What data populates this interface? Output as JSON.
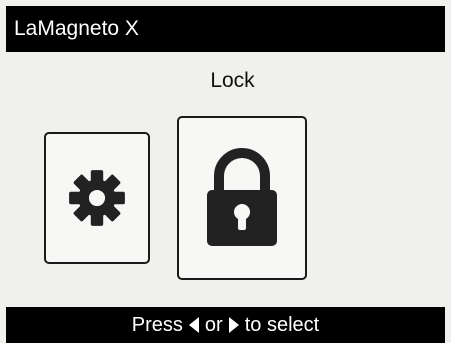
{
  "app": {
    "title": "LaMagneto X"
  },
  "menu": {
    "selected_label": "Lock",
    "tiles": [
      {
        "icon": "gear-icon",
        "label": "",
        "selected": false
      },
      {
        "icon": "lock-icon",
        "label": "",
        "selected": true
      }
    ]
  },
  "footer": {
    "press_text": "Press",
    "or_text": "or",
    "select_text": "to select",
    "left_arrow_icon": "arrow-left-icon",
    "right_arrow_icon": "arrow-right-icon"
  },
  "colors": {
    "bar_background": "#000000",
    "bar_text": "#ffffff",
    "screen_background": "#f0f0ed",
    "icon_fill": "#222222"
  }
}
